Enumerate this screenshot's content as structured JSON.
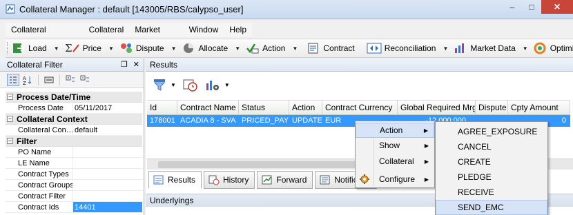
{
  "window": {
    "title": "Collateral Manager : default [143005/RBS/calypso_user]",
    "controls": {
      "minimize": "–",
      "maximize": "□",
      "close": "✕"
    }
  },
  "menubar": [
    "Collateral Manager",
    "Collateral",
    "Market Data",
    "Window",
    "Help"
  ],
  "toolbar": [
    {
      "label": "Load",
      "icon": "load-icon"
    },
    {
      "label": "Price",
      "icon": "price-icon"
    },
    {
      "label": "Dispute",
      "icon": "dispute-icon"
    },
    {
      "label": "Allocate",
      "icon": "allocate-icon"
    },
    {
      "label": "Action",
      "icon": "action-icon"
    },
    {
      "label": "Contract",
      "icon": "contract-icon"
    },
    {
      "label": "Reconciliation",
      "icon": "reconciliation-icon"
    },
    {
      "label": "Market Data",
      "icon": "market-data-icon"
    },
    {
      "label": "Optimize",
      "icon": "optimize-icon"
    }
  ],
  "filter_panel": {
    "title": "Collateral Filter",
    "categories": [
      {
        "name": "Process Date/Time",
        "rows": [
          {
            "name": "Process Date",
            "value": "05/11/2017"
          }
        ]
      },
      {
        "name": "Collateral Context",
        "rows": [
          {
            "name": "Collateral Con…",
            "value": "default"
          }
        ]
      },
      {
        "name": "Filter",
        "rows": [
          {
            "name": "PO Name",
            "value": ""
          },
          {
            "name": "LE Name",
            "value": ""
          },
          {
            "name": "Contract Types",
            "value": ""
          },
          {
            "name": "Contract Groups",
            "value": ""
          },
          {
            "name": "Contract Filter",
            "value": ""
          },
          {
            "name": "Contract Ids",
            "value": "14401"
          }
        ]
      }
    ]
  },
  "results_panel": {
    "title": "Results",
    "columns": [
      "Id",
      "Contract Name",
      "Status",
      "Action",
      "Contract Currency",
      "Global Required Mrg",
      "Dispute",
      "Cpty Amount"
    ],
    "rows": [
      {
        "id": "178001",
        "contract_name": "ACADIA 8 - SVA",
        "status": "PRICED_PAY",
        "action": "UPDATE",
        "currency": "EUR",
        "global_required_mrg": "-12,000,000",
        "dispute": "",
        "cpty_amount": "0"
      }
    ],
    "tabs": [
      "Results",
      "History",
      "Forward",
      "Notificatio"
    ],
    "underlyings_label": "Underlyings"
  },
  "context_menu": {
    "items": [
      {
        "label": "Action",
        "has_submenu": true,
        "highlighted": true
      },
      {
        "label": "Show",
        "has_submenu": true
      },
      {
        "label": "Collateral",
        "has_submenu": true
      },
      {
        "label": "Configure",
        "has_submenu": true
      }
    ],
    "submenu": [
      "AGREE_EXPOSURE",
      "CANCEL",
      "CREATE",
      "PLEDGE",
      "RECEIVE",
      "SEND_EMC"
    ],
    "submenu_highlighted": "SEND_EMC"
  },
  "colors": {
    "selection": "#3399ff",
    "menu_highlight": "#d5e4f6",
    "title_bar": "#c9daf0"
  }
}
